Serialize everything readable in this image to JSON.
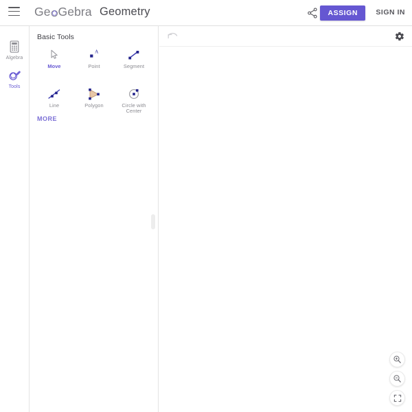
{
  "header": {
    "menu_icon": "hamburger-menu-icon",
    "brand_part1": "Ge",
    "brand_part2": "Gebra",
    "app_title": "Geometry",
    "share_icon": "share-icon",
    "assign_label": "ASSIGN",
    "signin_label": "SIGN IN",
    "accent_color": "#6557d2"
  },
  "rail": {
    "items": [
      {
        "label": "Algebra",
        "icon": "calculator-icon",
        "active": false
      },
      {
        "label": "Tools",
        "icon": "tools-icon",
        "active": true
      }
    ]
  },
  "toolpanel": {
    "heading": "Basic Tools",
    "more_label": "MORE",
    "tools": [
      {
        "label": "Move",
        "icon": "cursor-arrow-icon",
        "active": true
      },
      {
        "label": "Point",
        "icon": "point-icon",
        "active": false
      },
      {
        "label": "Segment",
        "icon": "segment-icon",
        "active": false
      },
      {
        "label": "Line",
        "icon": "line-icon",
        "active": false
      },
      {
        "label": "Polygon",
        "icon": "polygon-icon",
        "active": false
      },
      {
        "label": "Circle with Center",
        "icon": "circle-with-center-icon",
        "active": false
      }
    ]
  },
  "canvas": {
    "undo_icon": "undo-arrow-icon",
    "settings_icon": "gear-icon",
    "zoom_in_icon": "zoom-in-icon",
    "zoom_out_icon": "zoom-out-icon",
    "fit_screen_icon": "fit-to-screen-icon"
  }
}
